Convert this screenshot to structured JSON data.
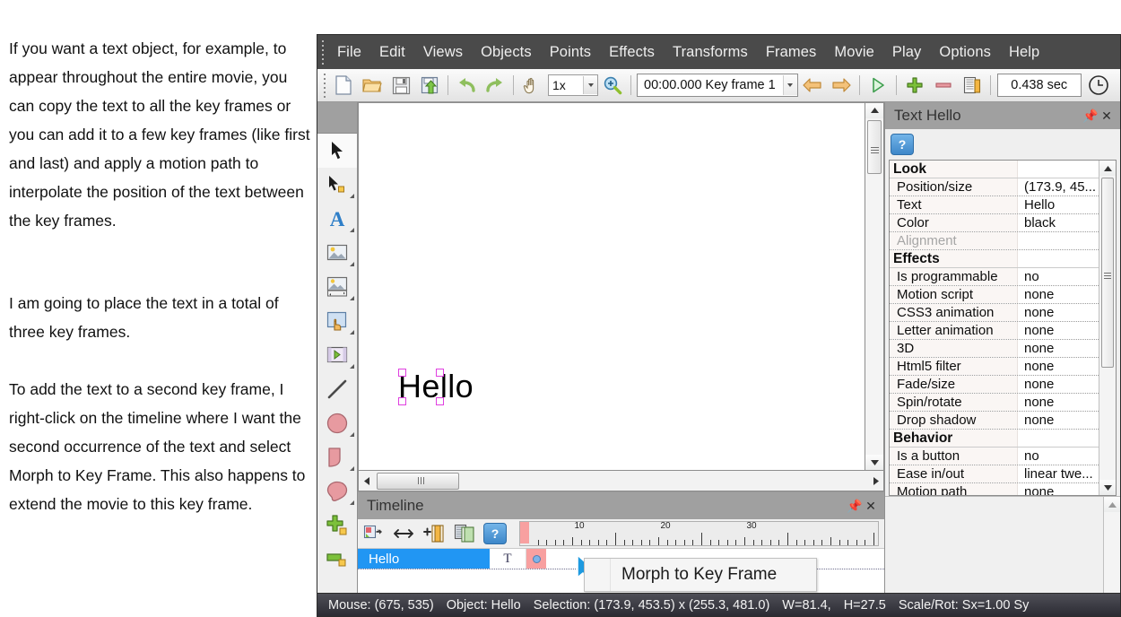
{
  "article": {
    "paragraph1": "If you want a text object, for example, to appear throughout the entire movie, you can copy the text to all the key frames or you can add it to a few key frames (like first and last) and apply a motion path to interpolate the position of the text between the key frames.",
    "paragraph2": "I am going to place the text in a total of three key frames.",
    "paragraph3": "To add the text to a second key frame, I right-click on the timeline where I want the second occurrence of the text and select Morph to Key Frame. This also happens to extend the movie to this key frame."
  },
  "menubar": {
    "items": [
      {
        "label": "File"
      },
      {
        "label": "Edit"
      },
      {
        "label": "Views"
      },
      {
        "label": "Objects"
      },
      {
        "label": "Points"
      },
      {
        "label": "Effects"
      },
      {
        "label": "Transforms"
      },
      {
        "label": "Frames"
      },
      {
        "label": "Movie"
      },
      {
        "label": "Play"
      },
      {
        "label": "Options"
      },
      {
        "label": "Help"
      }
    ]
  },
  "toolbar": {
    "buttons": [
      {
        "name": "new-document-icon"
      },
      {
        "name": "open-folder-icon"
      },
      {
        "name": "save-disk-icon"
      },
      {
        "name": "export-icon"
      },
      {
        "name": "undo-icon"
      },
      {
        "name": "redo-icon"
      },
      {
        "name": "pan-hand-icon"
      }
    ],
    "zoom_value": "1x",
    "time_value": "00:00.000  Key frame 1",
    "nav_prev": "previous-frame-icon",
    "nav_next": "next-frame-icon",
    "play": "play-icon",
    "add_frame": "add-frame-icon",
    "remove_frame": "remove-frame-icon",
    "copy_frame": "copy-frame-icon",
    "duration_value": "0.438 sec",
    "clock": "clock-icon"
  },
  "tools": {
    "items": [
      {
        "name": "select-arrow-tool",
        "selected": true
      },
      {
        "name": "point-select-tool",
        "selected": false
      },
      {
        "name": "text-tool",
        "selected": false
      },
      {
        "name": "image-tool",
        "selected": false
      },
      {
        "name": "image-sequence-tool",
        "selected": false
      },
      {
        "name": "button-tool",
        "selected": false
      },
      {
        "name": "movie-clip-tool",
        "selected": false
      },
      {
        "name": "line-tool",
        "selected": false
      },
      {
        "name": "ellipse-tool",
        "selected": false
      },
      {
        "name": "shape-tool",
        "selected": false
      },
      {
        "name": "blob-tool",
        "selected": false
      },
      {
        "name": "add-point-tool",
        "selected": false
      },
      {
        "name": "bar-tool",
        "selected": false
      }
    ]
  },
  "canvas": {
    "object_text": "Hello"
  },
  "timeline": {
    "title": "Timeline",
    "pin": "pin-icon",
    "close": "close-icon",
    "buttons": [
      {
        "name": "insert-object-icon"
      },
      {
        "name": "stretch-icon"
      },
      {
        "name": "add-frame-icon"
      },
      {
        "name": "duplicate-frame-icon"
      },
      {
        "name": "help-icon"
      }
    ],
    "ruler_labels": [
      "10",
      "20",
      "30"
    ],
    "track": {
      "name": "Hello",
      "type_icon": "T",
      "keyframe_marker": "keyframe-dot"
    },
    "context_menu": {
      "item": "Morph to Key Frame"
    }
  },
  "properties": {
    "title": "Text Hello",
    "pin": "pin-icon",
    "close": "close-icon",
    "help_button": "?",
    "rows": [
      {
        "key": "Look",
        "value": "",
        "category": true
      },
      {
        "key": "Position/size",
        "value": "(173.9, 45...",
        "category": false
      },
      {
        "key": "Text",
        "value": "Hello",
        "category": false
      },
      {
        "key": "Color",
        "value": "black",
        "category": false
      },
      {
        "key": "Alignment",
        "value": "",
        "category": false,
        "dim": true
      },
      {
        "key": "Effects",
        "value": "",
        "category": true
      },
      {
        "key": "Is programmable",
        "value": "no",
        "category": false
      },
      {
        "key": "Motion script",
        "value": "none",
        "category": false
      },
      {
        "key": "CSS3 animation",
        "value": "none",
        "category": false
      },
      {
        "key": "Letter animation",
        "value": "none",
        "category": false
      },
      {
        "key": "3D",
        "value": "none",
        "category": false
      },
      {
        "key": "Html5 filter",
        "value": "none",
        "category": false
      },
      {
        "key": "Fade/size",
        "value": "none",
        "category": false
      },
      {
        "key": "Spin/rotate",
        "value": "none",
        "category": false
      },
      {
        "key": "Drop shadow",
        "value": "none",
        "category": false
      },
      {
        "key": "Behavior",
        "value": "",
        "category": true
      },
      {
        "key": "Is a button",
        "value": "no",
        "category": false
      },
      {
        "key": "Ease in/out",
        "value": "linear twe...",
        "category": false
      },
      {
        "key": "Motion path",
        "value": "none",
        "category": false
      }
    ]
  },
  "statusbar": {
    "mouse": "Mouse: (675, 535)",
    "object": "Object: Hello",
    "selection": "Selection: (173.9, 453.5) x (255.3, 481.0)",
    "width": "W=81.4,",
    "height": "H=27.5",
    "scale": "Scale/Rot: Sx=1.00 Sy"
  },
  "colors": {
    "menubar_bg": "#4a4a4a",
    "accent_blue": "#2196f3",
    "keyframe_red": "#f8a0a0",
    "handle_magenta": "#e040e0",
    "panel_header": "#a0a0a0"
  }
}
